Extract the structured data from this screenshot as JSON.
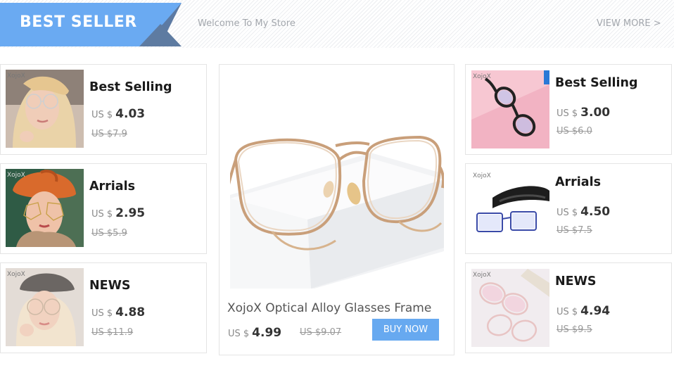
{
  "header": {
    "title": "BEST SELLER",
    "welcome": "Welcome To My Store",
    "view_more": "VIEW MORE >"
  },
  "left": [
    {
      "title": "Best Selling",
      "currency": "US $",
      "price": "4.03",
      "old_price": "US $7.9"
    },
    {
      "title": "Arrials",
      "currency": "US $",
      "price": "2.95",
      "old_price": "US $5.9"
    },
    {
      "title": "NEWS",
      "currency": "US $",
      "price": "4.88",
      "old_price": "US $11.9"
    }
  ],
  "featured": {
    "name": "XojoX Optical Alloy Glasses Frame",
    "currency": "US $",
    "price": "4.99",
    "old_price": "US $9.07",
    "buy_label": "BUY NOW"
  },
  "right": [
    {
      "title": "Best Selling",
      "currency": "US $",
      "price": "3.00",
      "old_price": "US $6.0"
    },
    {
      "title": "Arrials",
      "currency": "US $",
      "price": "4.50",
      "old_price": "US $7.5"
    },
    {
      "title": "NEWS",
      "currency": "US $",
      "price": "4.94",
      "old_price": "US $9.5"
    }
  ],
  "colors": {
    "accent": "#6aaaf2",
    "accent_dark": "#5e7ba1",
    "button": "#67a9f0"
  }
}
